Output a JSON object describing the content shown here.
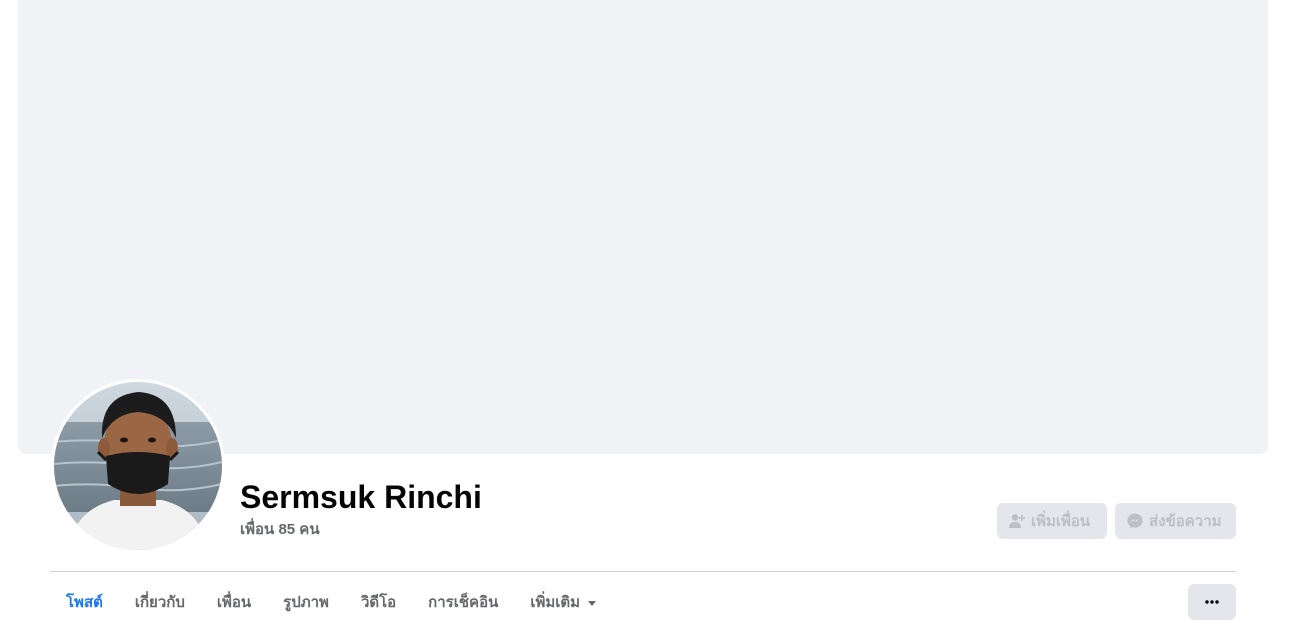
{
  "profile": {
    "name": "Sermsuk Rinchi",
    "friends_count": "เพื่อน 85 คน"
  },
  "actions": {
    "add_friend": {
      "label": "เพิ่มเพื่อน",
      "icon": "add-friend-icon"
    },
    "send_message": {
      "label": "ส่งข้อความ",
      "icon": "messenger-icon"
    },
    "more": {
      "icon": "more-dots-icon"
    }
  },
  "tabs": [
    {
      "label": "โพสต์",
      "active": true
    },
    {
      "label": "เกี่ยวกับ",
      "active": false
    },
    {
      "label": "เพื่อน",
      "active": false
    },
    {
      "label": "รูปภาพ",
      "active": false
    },
    {
      "label": "วิดีโอ",
      "active": false
    },
    {
      "label": "การเช็คอิน",
      "active": false
    },
    {
      "label": "เพิ่มเติม",
      "active": false,
      "dropdown": true
    }
  ],
  "colors": {
    "accent": "#1877f2",
    "cover": "#f0f2f5",
    "button_bg": "#e4e6eb",
    "muted_text": "#65676b",
    "disabled_text": "#bcc0c4"
  }
}
